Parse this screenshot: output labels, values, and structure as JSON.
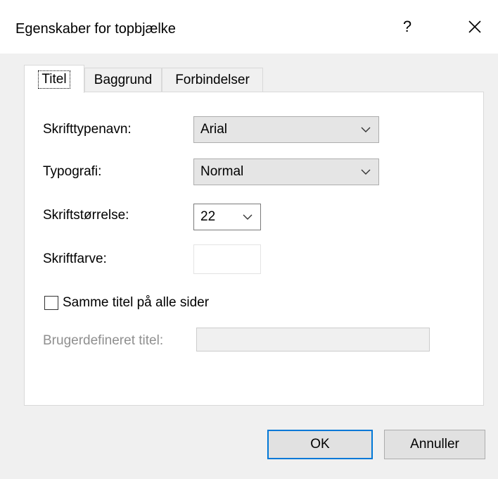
{
  "window": {
    "title": "Egenskaber for topbjælke",
    "help_label": "?"
  },
  "tabs": [
    {
      "label": "Titel",
      "active": true
    },
    {
      "label": "Baggrund",
      "active": false
    },
    {
      "label": "Forbindelser",
      "active": false
    }
  ],
  "form": {
    "font_name_label": "Skrifttypenavn:",
    "font_name_value": "Arial",
    "style_label": "Typografi:",
    "style_value": "Normal",
    "size_label": "Skriftstørrelse:",
    "size_value": "22",
    "color_label": "Skriftfarve:",
    "color_value": "#ffffff",
    "same_title_label": "Samme titel på alle sider",
    "same_title_checked": false,
    "custom_title_label": "Brugerdefineret titel:",
    "custom_title_value": ""
  },
  "buttons": {
    "ok_label": "OK",
    "cancel_label": "Annuller"
  }
}
